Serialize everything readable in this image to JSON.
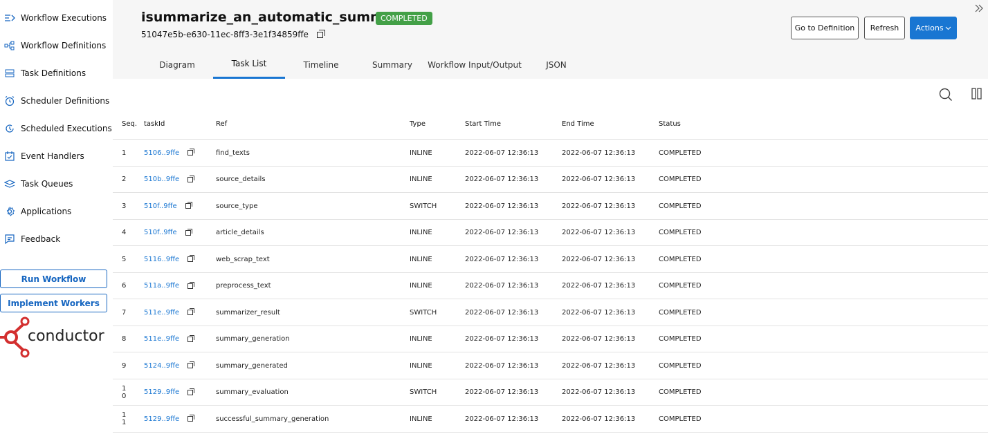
{
  "sidebar": {
    "items": [
      {
        "label": "Workflow Executions",
        "icon": "workflow-executions-icon"
      },
      {
        "label": "Workflow Definitions",
        "icon": "workflow-definitions-icon"
      },
      {
        "label": "Task Definitions",
        "icon": "task-definitions-icon"
      },
      {
        "label": "Scheduler Definitions",
        "icon": "scheduler-icon"
      },
      {
        "label": "Scheduled Executions",
        "icon": "scheduled-executions-icon"
      },
      {
        "label": "Event Handlers",
        "icon": "event-handlers-icon"
      },
      {
        "label": "Task Queues",
        "icon": "task-queues-icon"
      },
      {
        "label": "Applications",
        "icon": "applications-icon"
      },
      {
        "label": "Feedback",
        "icon": "feedback-icon"
      }
    ],
    "run_workflow": "Run Workflow",
    "implement_workers": "Implement Workers",
    "logo_text": "conductor"
  },
  "header": {
    "title": "isummarize_an_automatic_summarizer",
    "status": "COMPLETED",
    "workflow_id": "51047e5b-e630-11ec-8ff3-3e1f34859ffe",
    "go_to_definition": "Go to Definition",
    "refresh": "Refresh",
    "actions": "Actions",
    "tabs": [
      "Diagram",
      "Task List",
      "Timeline",
      "Summary",
      "Workflow Input/Output",
      "JSON"
    ],
    "active_tab": "Task List"
  },
  "colors": {
    "accent": "#1976d2",
    "status_green": "#43a047",
    "logo_red": "#d32f2f"
  },
  "table": {
    "headers": {
      "seq": "Seq.",
      "taskId": "taskId",
      "ref": "Ref",
      "type": "Type",
      "start": "Start Time",
      "end": "End Time",
      "status": "Status"
    },
    "rows": [
      {
        "seq": "1",
        "taskId": "5106..9ffe",
        "ref": "find_texts",
        "type": "INLINE",
        "start": "2022-06-07 12:36:13",
        "end": "2022-06-07 12:36:13",
        "status": "COMPLETED"
      },
      {
        "seq": "2",
        "taskId": "510b..9ffe",
        "ref": "source_details",
        "type": "INLINE",
        "start": "2022-06-07 12:36:13",
        "end": "2022-06-07 12:36:13",
        "status": "COMPLETED"
      },
      {
        "seq": "3",
        "taskId": "510f..9ffe",
        "ref": "source_type",
        "type": "SWITCH",
        "start": "2022-06-07 12:36:13",
        "end": "2022-06-07 12:36:13",
        "status": "COMPLETED"
      },
      {
        "seq": "4",
        "taskId": "510f..9ffe",
        "ref": "article_details",
        "type": "INLINE",
        "start": "2022-06-07 12:36:13",
        "end": "2022-06-07 12:36:13",
        "status": "COMPLETED"
      },
      {
        "seq": "5",
        "taskId": "5116..9ffe",
        "ref": "web_scrap_text",
        "type": "INLINE",
        "start": "2022-06-07 12:36:13",
        "end": "2022-06-07 12:36:13",
        "status": "COMPLETED"
      },
      {
        "seq": "6",
        "taskId": "511a..9ffe",
        "ref": "preprocess_text",
        "type": "INLINE",
        "start": "2022-06-07 12:36:13",
        "end": "2022-06-07 12:36:13",
        "status": "COMPLETED"
      },
      {
        "seq": "7",
        "taskId": "511e..9ffe",
        "ref": "summarizer_result",
        "type": "SWITCH",
        "start": "2022-06-07 12:36:13",
        "end": "2022-06-07 12:36:13",
        "status": "COMPLETED"
      },
      {
        "seq": "8",
        "taskId": "511e..9ffe",
        "ref": "summary_generation",
        "type": "INLINE",
        "start": "2022-06-07 12:36:13",
        "end": "2022-06-07 12:36:13",
        "status": "COMPLETED"
      },
      {
        "seq": "9",
        "taskId": "5124..9ffe",
        "ref": "summary_generated",
        "type": "INLINE",
        "start": "2022-06-07 12:36:13",
        "end": "2022-06-07 12:36:13",
        "status": "COMPLETED"
      },
      {
        "seq": "1\n0",
        "taskId": "5129..9ffe",
        "ref": "summary_evaluation",
        "type": "SWITCH",
        "start": "2022-06-07 12:36:13",
        "end": "2022-06-07 12:36:13",
        "status": "COMPLETED"
      },
      {
        "seq": "1\n1",
        "taskId": "5129..9ffe",
        "ref": "successful_summary_generation",
        "type": "INLINE",
        "start": "2022-06-07 12:36:13",
        "end": "2022-06-07 12:36:13",
        "status": "COMPLETED"
      }
    ]
  }
}
